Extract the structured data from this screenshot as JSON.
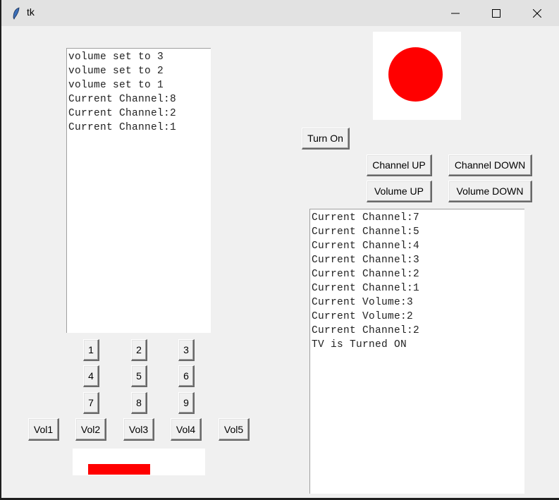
{
  "window": {
    "title": "tk",
    "controls": {
      "minimize": "minimize",
      "maximize": "maximize",
      "close": "close"
    }
  },
  "left_log": {
    "lines": [
      "volume set to 3",
      "volume set to 2",
      "volume set to 1",
      "Current Channel:8",
      "Current Channel:2",
      "Current Channel:1"
    ]
  },
  "right_log": {
    "lines": [
      "Current Channel:7",
      "Current Channel:5",
      "Current Channel:4",
      "Current Channel:3",
      "Current Channel:2",
      "Current Channel:1",
      "Current Volume:3",
      "Current Volume:2",
      "Current Channel:2",
      "TV is Turned ON"
    ]
  },
  "power": {
    "button_label": "Turn On",
    "indicator_color": "#ff0000",
    "indicator_bg": "#ffffff"
  },
  "controls": {
    "channel_up": "Channel UP",
    "channel_down": "Channel DOWN",
    "volume_up": "Volume UP",
    "volume_down": "Volume DOWN"
  },
  "keypad": {
    "keys": [
      "1",
      "2",
      "3",
      "4",
      "5",
      "6",
      "7",
      "8",
      "9"
    ]
  },
  "volume_presets": [
    "Vol1",
    "Vol2",
    "Vol3",
    "Vol4",
    "Vol5"
  ],
  "volume_bar": {
    "level_fraction": 0.55,
    "fill_color": "#ff0000"
  }
}
